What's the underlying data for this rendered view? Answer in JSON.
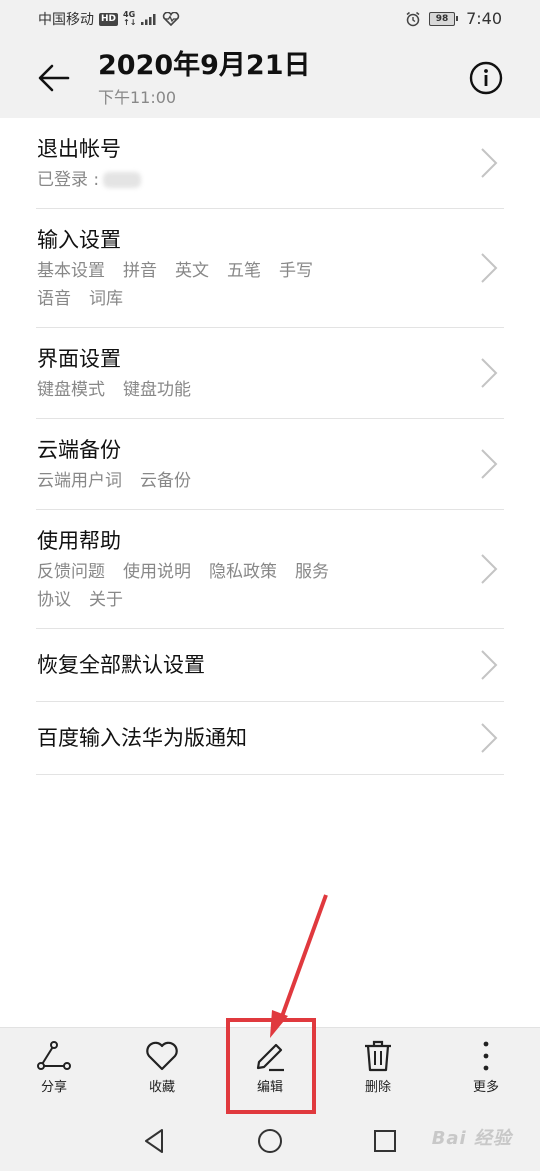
{
  "status_bar": {
    "carrier": "中国移动",
    "hd": "HD",
    "network_top": "4G",
    "network_bottom": "↑↓",
    "battery": "98",
    "time": "7:40"
  },
  "header": {
    "title": "2020年9月21日",
    "subtitle": "下午11:00"
  },
  "list": [
    {
      "title": "退出帐号",
      "logged_in_label": "已登录 :"
    },
    {
      "title": "输入设置",
      "subs": [
        "基本设置",
        "拼音",
        "英文",
        "五笔",
        "手写",
        "语音",
        "词库"
      ]
    },
    {
      "title": "界面设置",
      "subs": [
        "键盘模式",
        "键盘功能"
      ]
    },
    {
      "title": "云端备份",
      "subs": [
        "云端用户词",
        "云备份"
      ]
    },
    {
      "title": "使用帮助",
      "subs": [
        "反馈问题",
        "使用说明",
        "隐私政策",
        "服务",
        "协议",
        "关于"
      ]
    },
    {
      "title": "恢复全部默认设置"
    },
    {
      "title": "百度输入法华为版通知"
    }
  ],
  "toolbar": {
    "share": "分享",
    "favorite": "收藏",
    "edit": "编辑",
    "delete": "删除",
    "more": "更多"
  },
  "watermark": "Bai 经验",
  "colors": {
    "highlight": "#e0393e",
    "bar_bg": "#f1f1f1"
  }
}
